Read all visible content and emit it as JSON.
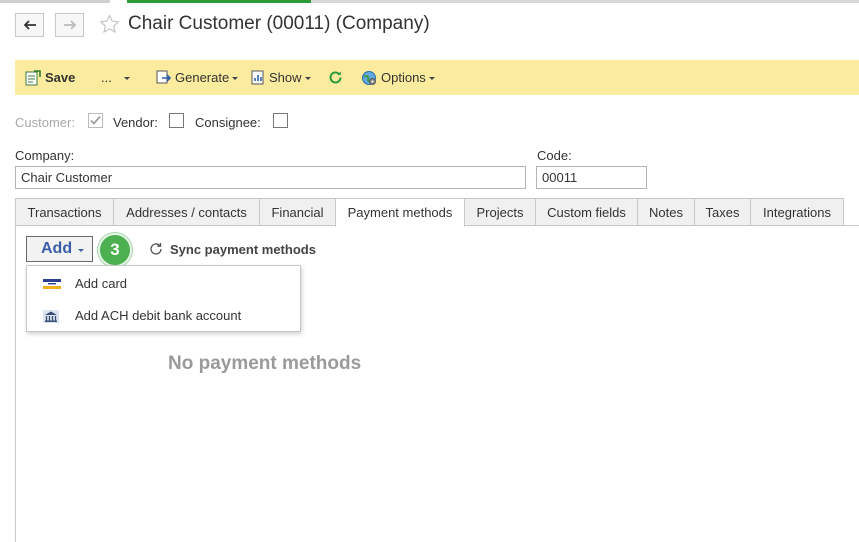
{
  "window": {
    "title": "Chair Customer (00011) (Company)"
  },
  "nav": {
    "back_icon": "arrow-left-icon",
    "forward_icon": "arrow-right-icon",
    "favorite_icon": "star-icon"
  },
  "toolbar": {
    "save_label": "Save",
    "more_label": "...",
    "generate_label": "Generate",
    "show_label": "Show",
    "options_label": "Options"
  },
  "flags": {
    "customer_label": "Customer:",
    "customer_checked": true,
    "vendor_label": "Vendor:",
    "vendor_checked": false,
    "consignee_label": "Consignee:",
    "consignee_checked": false
  },
  "fields": {
    "company_label": "Company:",
    "company_value": "Chair Customer",
    "code_label": "Code:",
    "code_value": "00011"
  },
  "tabs": [
    {
      "label": "Transactions"
    },
    {
      "label": "Addresses / contacts"
    },
    {
      "label": "Financial"
    },
    {
      "label": "Payment methods",
      "active": true
    },
    {
      "label": "Projects"
    },
    {
      "label": "Custom fields"
    },
    {
      "label": "Notes"
    },
    {
      "label": "Taxes"
    },
    {
      "label": "Integrations"
    }
  ],
  "payment_methods": {
    "add_label": "Add",
    "step_badge": "3",
    "sync_label": "Sync payment methods",
    "menu": [
      {
        "label": "Add card",
        "icon": "credit-card-icon"
      },
      {
        "label": "Add ACH debit bank account",
        "icon": "bank-icon"
      }
    ],
    "empty_text": "No payment methods"
  },
  "colors": {
    "toolbar_bg": "#fbeb9e",
    "badge_green": "#4caf50",
    "add_blue": "#3b5fa6"
  }
}
